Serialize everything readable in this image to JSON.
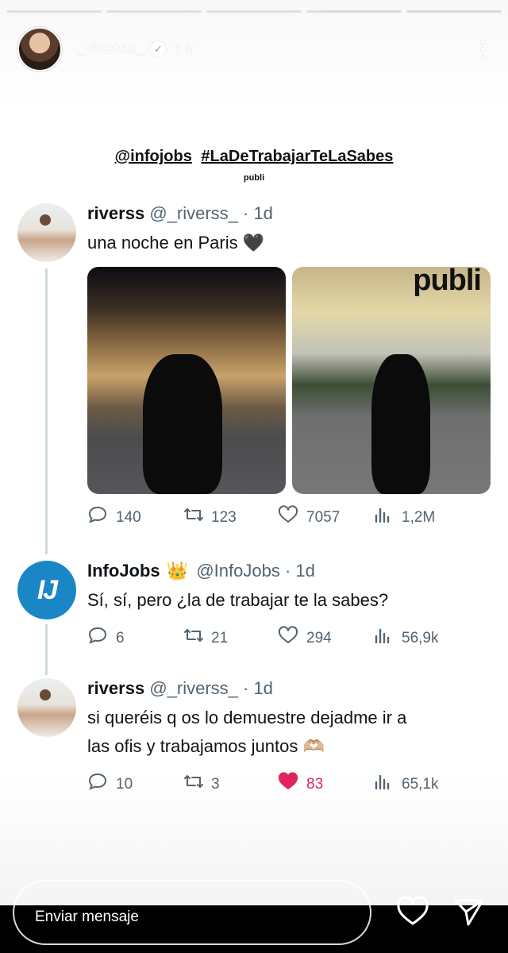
{
  "story": {
    "progress_segments": [
      1,
      1,
      1,
      0.15,
      0
    ],
    "username": "_riverss_",
    "time": "1 h",
    "caption_mentions": [
      "@infojobs",
      "#LaDeTrabajarTeLaSabes"
    ],
    "caption_sub": "publi",
    "message_placeholder": "Enviar mensaje"
  },
  "tweets": [
    {
      "name": "riverss",
      "handle": "@_riverss_ · 1d",
      "text": "una noche en Paris 🖤",
      "photo_overlay": "publi",
      "replies": "140",
      "retweets": "123",
      "likes": "7057",
      "views": "1,2M",
      "liked": false
    },
    {
      "name": "InfoJobs",
      "badge": "👑",
      "avatar_text": "IJ",
      "handle": "@InfoJobs · 1d",
      "text": "Sí, sí, pero ¿la de trabajar te la sabes?",
      "replies": "6",
      "retweets": "21",
      "likes": "294",
      "views": "56,9k",
      "liked": false
    },
    {
      "name": "riverss",
      "handle": "@_riverss_ · 1d",
      "text_line1": "si queréis q os lo demuestre dejadme ir a",
      "text_line2": "las ofis y trabajamos juntos 🫶🏼",
      "replies": "10",
      "retweets": "3",
      "likes": "83",
      "views": "65,1k",
      "liked": true
    }
  ],
  "icons": {
    "reply": "💬",
    "retweet": "⟲",
    "like": "♡",
    "like_filled": "♥",
    "views": "📊",
    "verified": "✓"
  },
  "colors": {
    "accent_like": "#e0245e",
    "infojobs_blue": "#1b86c6",
    "secondary_text": "#536471"
  }
}
